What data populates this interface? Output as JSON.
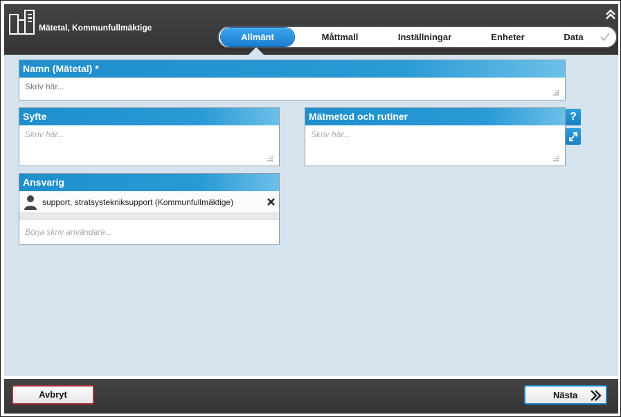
{
  "header": {
    "title": "Mätetal, Kommunfullmäktige",
    "icons": {
      "app": "chart-document-icon",
      "collapse": "double-chevron-up-icon"
    }
  },
  "tabs": [
    {
      "label": "Allmänt",
      "active": true
    },
    {
      "label": "Måttmall",
      "active": false
    },
    {
      "label": "Inställningar",
      "active": false
    },
    {
      "label": "Enheter",
      "active": false
    },
    {
      "label": "Data",
      "active": false
    }
  ],
  "fields": {
    "name": {
      "label": "Namn (Mätetal) *",
      "placeholder": "Skriv här...",
      "value": ""
    },
    "purpose": {
      "label": "Syfte",
      "placeholder": "Skriv här...",
      "value": ""
    },
    "method": {
      "label": "Mätmetod och rutiner",
      "placeholder": "Skriv här...",
      "value": ""
    },
    "responsible": {
      "label": "Ansvarig",
      "selected_user": "support, stratsystekniksupport (Kommunfullmäktige)",
      "placeholder": "Börja skriv användare..."
    }
  },
  "side_buttons": {
    "help": "?",
    "expand": "expand-arrows-icon"
  },
  "footer": {
    "cancel_label": "Avbryt",
    "next_label": "Nästa"
  },
  "colors": {
    "accent": "#1f8fcc",
    "header_bg": "#3a3a3a",
    "content_bg": "#d4e3ee",
    "cancel_border": "#a8353b",
    "next_border": "#1e88d0"
  }
}
